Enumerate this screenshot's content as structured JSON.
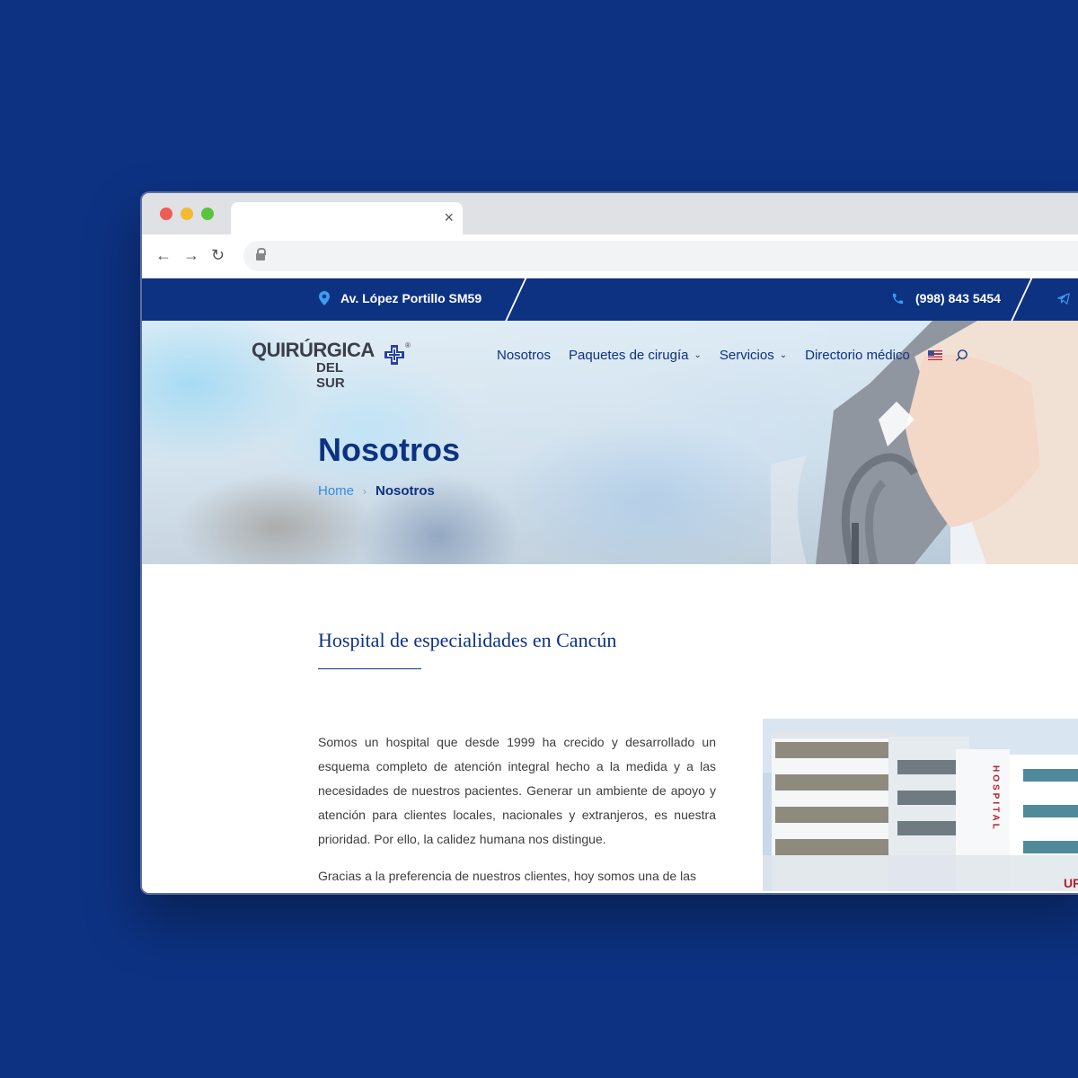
{
  "browser": {
    "tab_title": "",
    "tab_close": "×",
    "back": "←",
    "forward": "→",
    "reload": "↻",
    "url": ""
  },
  "topbar": {
    "address": "Av. López Portillo SM59",
    "phone": "(998) 843 5454"
  },
  "logo": {
    "main": "QUIRÚRGICA",
    "sub": "DEL SUR",
    "reg": "®"
  },
  "nav": {
    "items": [
      {
        "label": "Nosotros"
      },
      {
        "label": "Paquetes de cirugía",
        "chevron": "⌄"
      },
      {
        "label": "Servicios",
        "chevron": "⌄"
      },
      {
        "label": "Directorio médico"
      }
    ]
  },
  "hero": {
    "title": "Nosotros",
    "breadcrumb": {
      "home": "Home",
      "separator": "›",
      "current": "Nosotros"
    }
  },
  "content": {
    "title": "Hospital de especialidades en Cancún",
    "paragraph1": "Somos un hospital que desde 1999 ha crecido y desarrollado un esquema completo de atención integral hecho a la medida y a las necesidades de nuestros pacientes. Generar un ambiente de apoyo y atención para clientes locales, nacionales y extranjeros, es nuestra prioridad. Por ello, la calidez humana nos distingue.",
    "paragraph2": "Gracias a la preferencia de nuestros clientes, hoy somos una de las",
    "building_sign": "HOSPITAL",
    "building_sign2": "UR"
  },
  "icons": [
    "location-pin-icon",
    "phone-icon",
    "telegram-icon",
    "search-icon",
    "us-flag-icon",
    "lock-icon",
    "close-icon"
  ],
  "colors": {
    "brand_navy": "#0d3282",
    "link_blue": "#2f8fe3",
    "background": "#0d3282",
    "text_gray": "#3d3d3d"
  }
}
